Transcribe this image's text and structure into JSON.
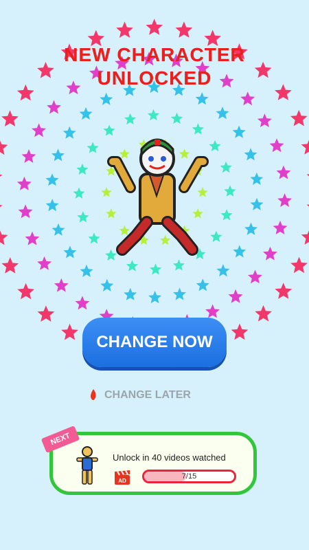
{
  "title": {
    "line1": "NEW CHARACTER",
    "line2": "UNLOCKED"
  },
  "buttons": {
    "change_now": "CHANGE NOW",
    "change_later": "CHANGE LATER"
  },
  "unlock": {
    "badge": "NEXT",
    "text": "Unlock in 40 videos watched",
    "ad_label": "AD",
    "progress_text": "7/15",
    "progress_value": 0.4667
  },
  "colors": {
    "accent_blue": "#2f7ff0",
    "title_red": "#e8201e",
    "card_green": "#33c53b",
    "star_colors": [
      "#f2376b",
      "#e040c8",
      "#35c1e8",
      "#3ee8c2",
      "#b7f03a"
    ]
  },
  "icons": {
    "later": "red-flame-icon",
    "ad": "clapperboard-ad-icon"
  }
}
